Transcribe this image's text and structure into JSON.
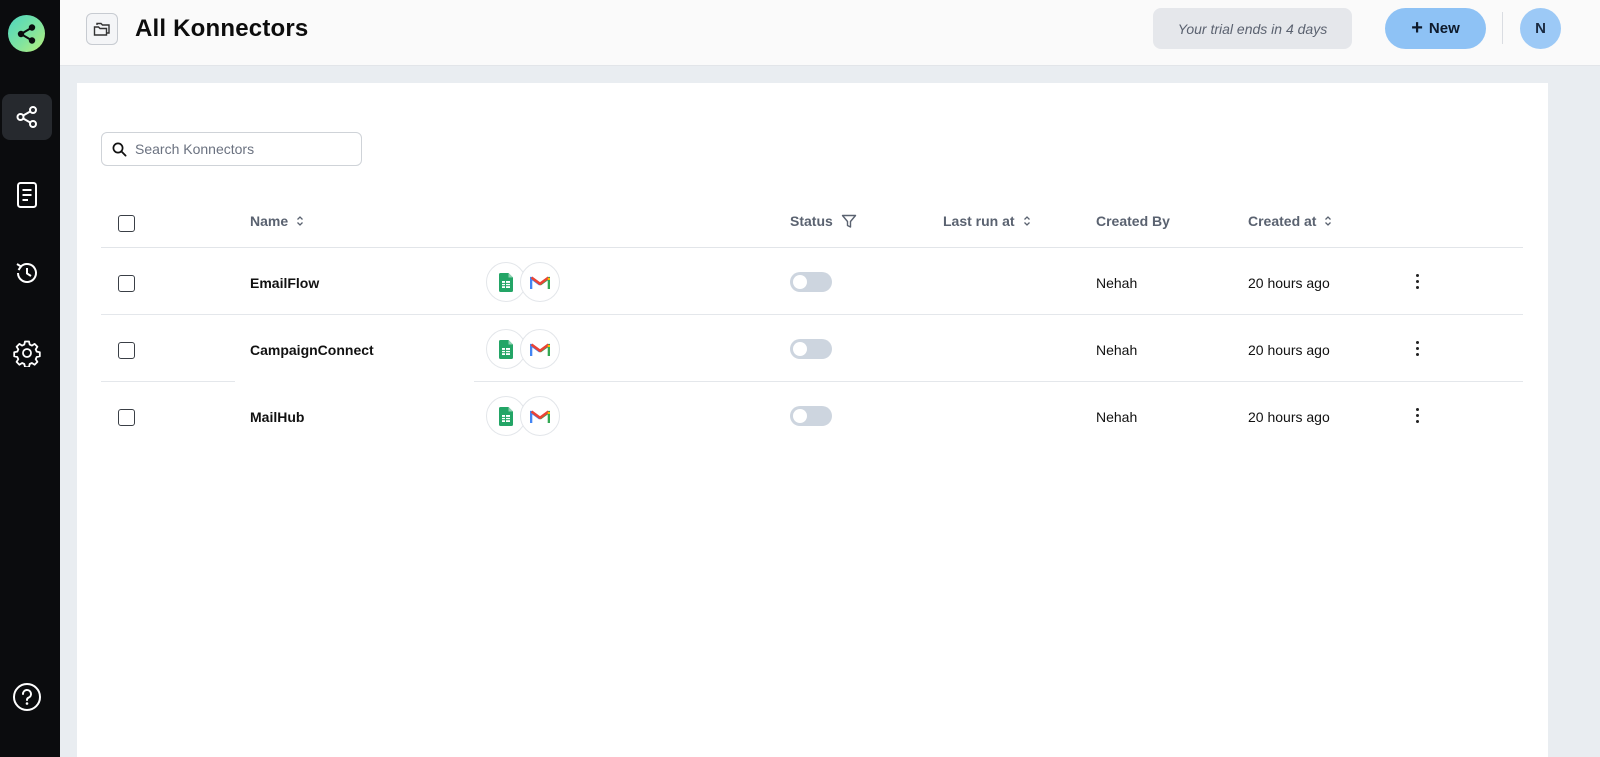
{
  "header": {
    "title": "All Konnectors",
    "trial_text": "Your trial ends in 4 days",
    "new_label": "New",
    "avatar_initial": "N"
  },
  "sidebar": {
    "items": [
      {
        "icon": "share-nodes-icon",
        "active": true
      },
      {
        "icon": "document-icon",
        "active": false
      },
      {
        "icon": "history-icon",
        "active": false
      },
      {
        "icon": "gear-icon",
        "active": false
      },
      {
        "icon": "help-icon",
        "active": false
      }
    ]
  },
  "search": {
    "placeholder": "Search Konnectors"
  },
  "table": {
    "columns": {
      "name": "Name",
      "status": "Status",
      "last_run": "Last run at",
      "created_by": "Created By",
      "created_at": "Created at"
    },
    "rows": [
      {
        "name": "EmailFlow",
        "apps": [
          "google-sheets-icon",
          "gmail-icon"
        ],
        "status_on": false,
        "last_run": "",
        "created_by": "Nehah",
        "created_at": "20 hours ago"
      },
      {
        "name": "CampaignConnect",
        "apps": [
          "google-sheets-icon",
          "gmail-icon"
        ],
        "status_on": false,
        "last_run": "",
        "created_by": "Nehah",
        "created_at": "20 hours ago"
      },
      {
        "name": "MailHub",
        "apps": [
          "google-sheets-icon",
          "gmail-icon"
        ],
        "status_on": false,
        "last_run": "",
        "created_by": "Nehah",
        "created_at": "20 hours ago"
      }
    ]
  },
  "colors": {
    "sidebar_bg": "#0b0c0e",
    "accent": "#8ec2f5",
    "toggle_off": "#cdd5df"
  }
}
